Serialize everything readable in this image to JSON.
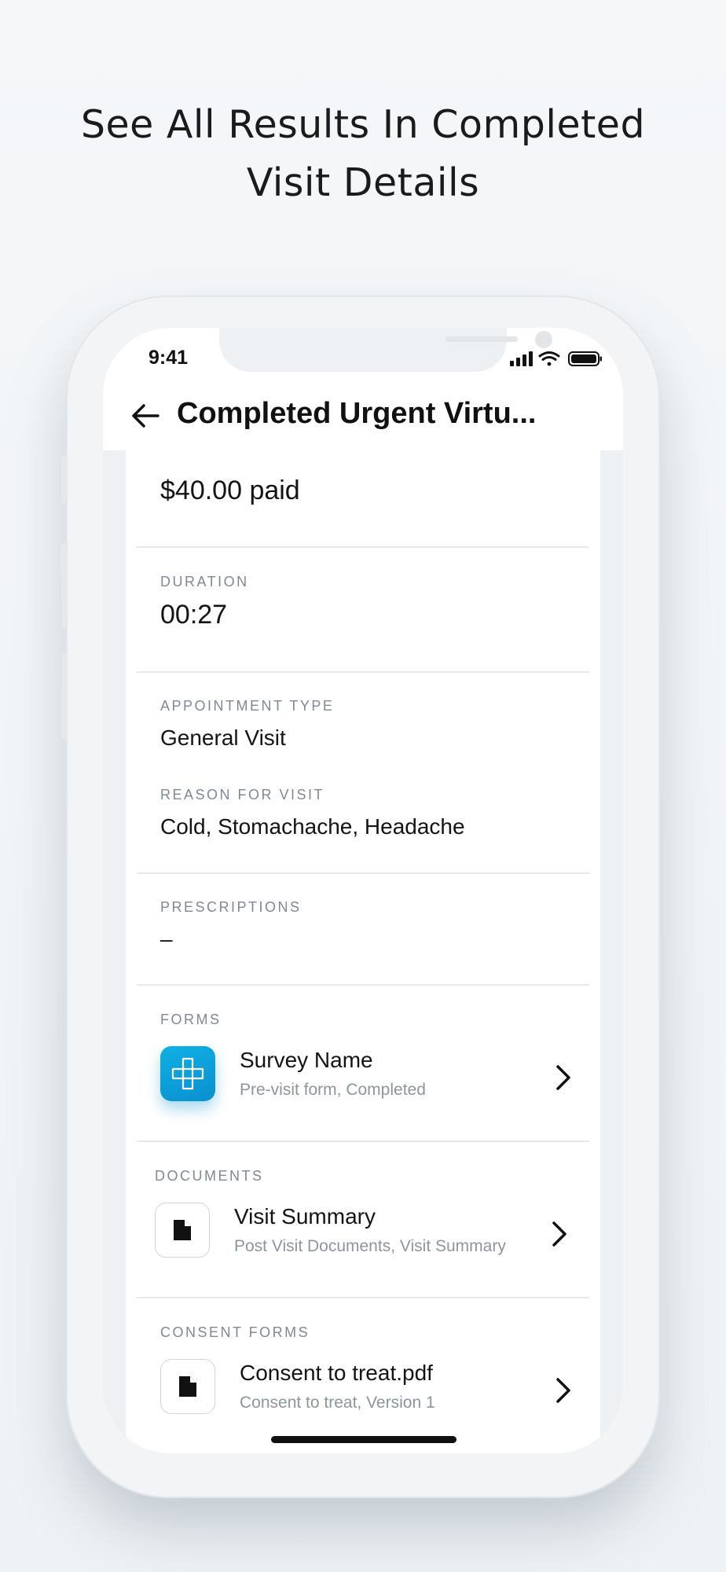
{
  "headline": {
    "line1": "See All Results In Completed",
    "line2": "Visit Details"
  },
  "status_bar": {
    "time": "9:41"
  },
  "header": {
    "title": "Completed Urgent Virtu..."
  },
  "payment": {
    "value": "$40.00 paid"
  },
  "duration": {
    "label": "DURATION",
    "value": "00:27"
  },
  "appointment_type": {
    "label": "APPOINTMENT TYPE",
    "value": "General Visit"
  },
  "reason": {
    "label": "REASON FOR VISIT",
    "value": "Cold, Stomachache, Headache"
  },
  "prescriptions": {
    "label": "PRESCRIPTIONS",
    "value": "–"
  },
  "forms": {
    "label": "FORMS",
    "item": {
      "title": "Survey Name",
      "subtitle": "Pre-visit form, Completed",
      "icon": "medical-cross-icon"
    }
  },
  "documents": {
    "label": "DOCUMENTS",
    "item": {
      "title": "Visit Summary",
      "subtitle": "Post Visit Documents, Visit Summary",
      "icon": "document-icon"
    }
  },
  "consent_forms": {
    "label": "CONSENT FORMS",
    "item": {
      "title": "Consent to treat.pdf",
      "subtitle": "Consent to treat, Version 1",
      "icon": "document-icon"
    }
  },
  "colors": {
    "accent": "#0a9ed9",
    "label": "#7d8a93",
    "divider": "#e6e9ec"
  }
}
